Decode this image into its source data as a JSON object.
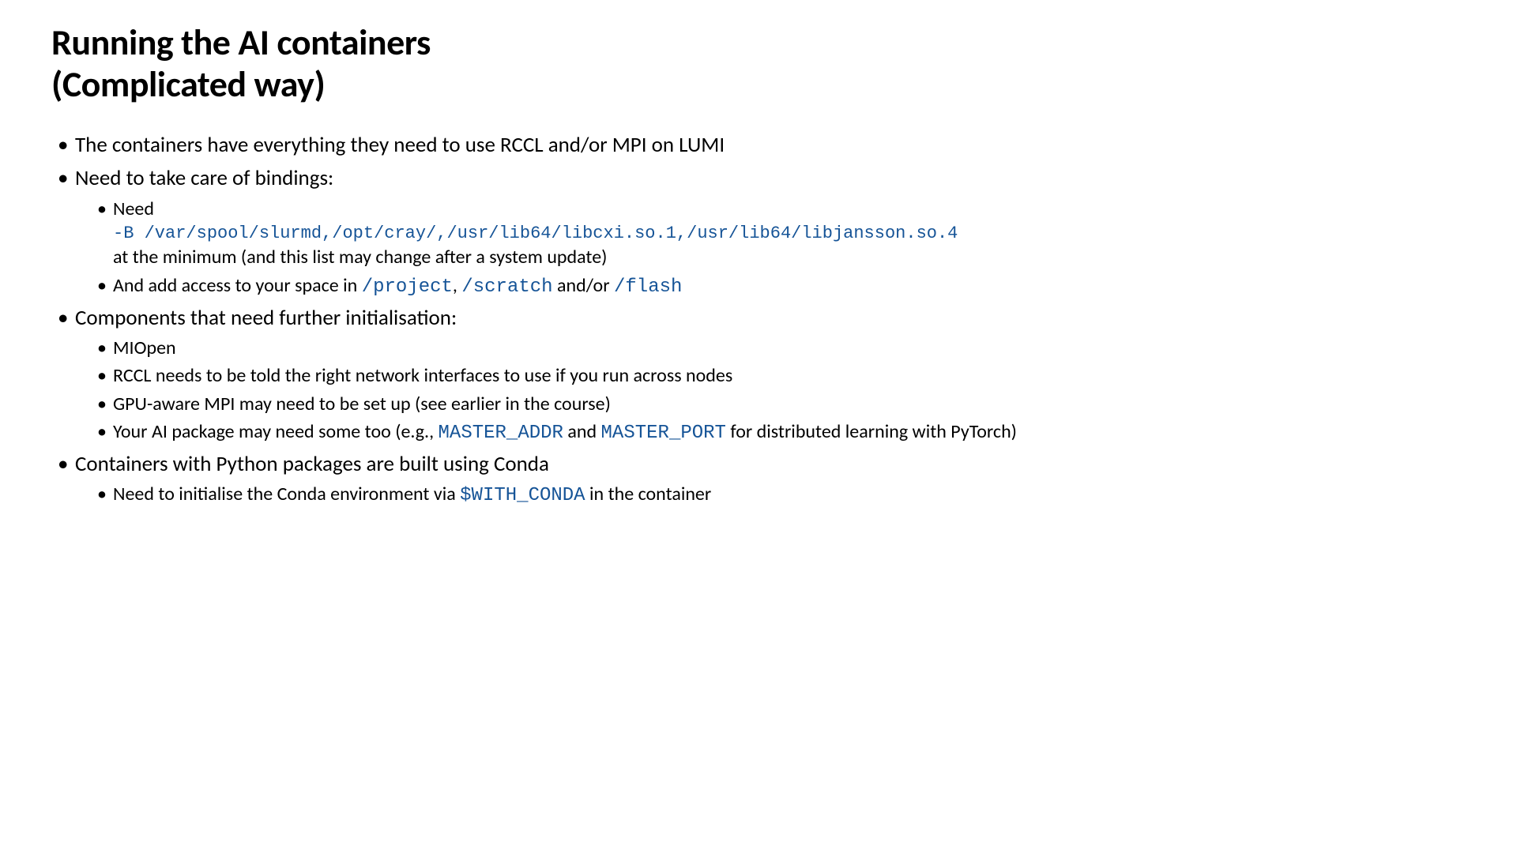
{
  "title_line1": "Running the AI containers",
  "title_line2": "(Complicated way)",
  "b1": "The containers have everything they need to use RCCL and/or MPI on LUMI",
  "b2": "Need to take care of bindings:",
  "b2_1_a": "Need",
  "b2_1_code": "-B /var/spool/slurmd,/opt/cray/,/usr/lib64/libcxi.so.1,/usr/lib64/libjansson.so.4",
  "b2_1_b": "at the minimum (and this list may change after a system update)",
  "b2_2_a": "And add access to your space in ",
  "b2_2_c1": "/project",
  "b2_2_b": ", ",
  "b2_2_c2": "/scratch",
  "b2_2_c": " and/or ",
  "b2_2_c3": "/flash",
  "b3": "Components that need further initialisation:",
  "b3_1": "MIOpen",
  "b3_2": "RCCL needs to be told the right network interfaces to use if you run across nodes",
  "b3_3": "GPU-aware MPI may need to be set up (see earlier in the course)",
  "b3_4_a": "Your AI package may need some too (e.g., ",
  "b3_4_c1": "MASTER_ADDR",
  "b3_4_b": " and ",
  "b3_4_c2": "MASTER_PORT",
  "b3_4_c": " for distributed learning with PyTorch)",
  "b4": "Containers with Python packages are built using Conda",
  "b4_1_a": "Need to initialise the Conda environment via ",
  "b4_1_c1": "$WITH_CONDA",
  "b4_1_b": " in the container"
}
